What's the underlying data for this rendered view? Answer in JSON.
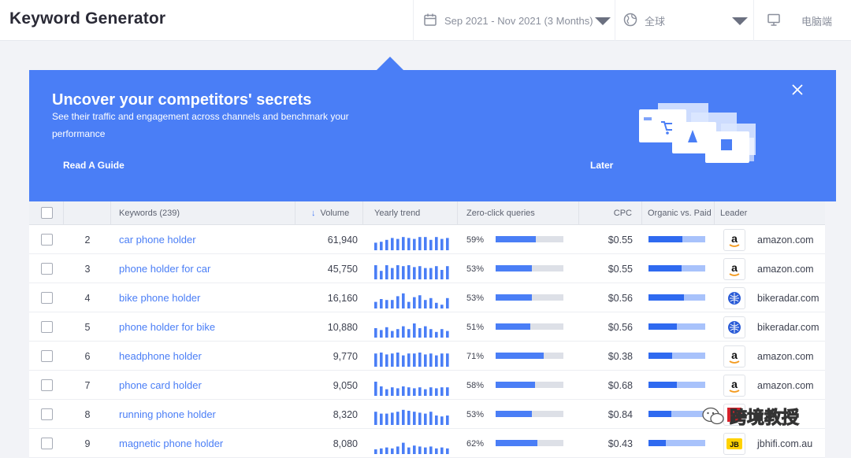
{
  "app": {
    "title": "Keyword Generator"
  },
  "filters": {
    "date_range": "Sep 2021 - Nov 2021 (3 Months)",
    "region": "全球",
    "device": "电脑端",
    "icons": [
      "calendar-icon",
      "globe-icon",
      "desktop-icon"
    ]
  },
  "banner": {
    "title": "Uncover your competitors' secrets",
    "subtitle": "See their traffic and engagement across channels and benchmark your performance",
    "guide_label": "Read A Guide",
    "later_label": "Later",
    "color": "#4a7ef6"
  },
  "table": {
    "headers": {
      "keywords": "Keywords (239)",
      "volume": "Volume",
      "trend": "Yearly trend",
      "zero_click": "Zero-click queries",
      "cpc": "CPC",
      "organic_paid": "Organic vs. Paid",
      "leader": "Leader"
    },
    "rows": [
      {
        "rank": "2",
        "keyword": "car phone holder",
        "volume": "61,940",
        "zero_click": "59%",
        "zero_click_value": 0.59,
        "cpc": "$0.55",
        "organic_share": 0.6,
        "leader": "amazon.com",
        "leader_icon": "amazon-logo-icon",
        "trend": [
          0.4,
          0.45,
          0.55,
          0.65,
          0.6,
          0.7,
          0.65,
          0.6,
          0.7,
          0.7,
          0.55,
          0.7,
          0.6,
          0.65
        ]
      },
      {
        "rank": "3",
        "keyword": "phone holder for car",
        "volume": "45,750",
        "zero_click": "53%",
        "zero_click_value": 0.53,
        "cpc": "$0.55",
        "organic_share": 0.58,
        "leader": "amazon.com",
        "leader_icon": "amazon-logo-icon",
        "trend": [
          0.75,
          0.45,
          0.75,
          0.6,
          0.75,
          0.7,
          0.75,
          0.65,
          0.7,
          0.6,
          0.6,
          0.7,
          0.5,
          0.7
        ]
      },
      {
        "rank": "4",
        "keyword": "bike phone holder",
        "volume": "16,160",
        "zero_click": "53%",
        "zero_click_value": 0.53,
        "cpc": "$0.56",
        "organic_share": 0.62,
        "leader": "bikeradar.com",
        "leader_icon": "bikeradar-logo-icon",
        "trend": [
          0.35,
          0.5,
          0.45,
          0.45,
          0.65,
          0.8,
          0.35,
          0.6,
          0.7,
          0.45,
          0.55,
          0.3,
          0.2,
          0.55
        ]
      },
      {
        "rank": "5",
        "keyword": "phone holder for bike",
        "volume": "10,880",
        "zero_click": "51%",
        "zero_click_value": 0.51,
        "cpc": "$0.56",
        "organic_share": 0.5,
        "leader": "bikeradar.com",
        "leader_icon": "bikeradar-logo-icon",
        "trend": [
          0.5,
          0.4,
          0.55,
          0.35,
          0.45,
          0.6,
          0.45,
          0.75,
          0.5,
          0.6,
          0.45,
          0.3,
          0.45,
          0.35
        ]
      },
      {
        "rank": "6",
        "keyword": "headphone holder",
        "volume": "9,770",
        "zero_click": "71%",
        "zero_click_value": 0.71,
        "cpc": "$0.38",
        "organic_share": 0.42,
        "leader": "amazon.com",
        "leader_icon": "amazon-logo-icon",
        "trend": [
          0.7,
          0.75,
          0.65,
          0.7,
          0.75,
          0.6,
          0.7,
          0.7,
          0.75,
          0.65,
          0.7,
          0.6,
          0.7,
          0.7
        ]
      },
      {
        "rank": "7",
        "keyword": "phone card holder",
        "volume": "9,050",
        "zero_click": "58%",
        "zero_click_value": 0.58,
        "cpc": "$0.68",
        "organic_share": 0.5,
        "leader": "amazon.com",
        "leader_icon": "amazon-logo-icon",
        "trend": [
          0.75,
          0.5,
          0.35,
          0.45,
          0.4,
          0.5,
          0.45,
          0.4,
          0.45,
          0.35,
          0.45,
          0.4,
          0.45,
          0.45
        ]
      },
      {
        "rank": "8",
        "keyword": "running phone holder",
        "volume": "8,320",
        "zero_click": "53%",
        "zero_click_value": 0.53,
        "cpc": "$0.84",
        "organic_share": 0.4,
        "leader": "",
        "leader_icon": "",
        "trend": [
          0.7,
          0.6,
          0.6,
          0.65,
          0.7,
          0.8,
          0.75,
          0.7,
          0.65,
          0.6,
          0.7,
          0.5,
          0.45,
          0.5
        ]
      },
      {
        "rank": "9",
        "keyword": "magnetic phone holder",
        "volume": "8,080",
        "zero_click": "62%",
        "zero_click_value": 0.62,
        "cpc": "$0.43",
        "organic_share": 0.3,
        "leader": "jbhifi.com.au",
        "leader_icon": "jb-hifi-logo-icon",
        "trend": [
          0.25,
          0.3,
          0.35,
          0.3,
          0.4,
          0.6,
          0.35,
          0.45,
          0.4,
          0.35,
          0.4,
          0.3,
          0.35,
          0.3
        ]
      }
    ]
  },
  "watermark": {
    "text": "跨境教授"
  }
}
